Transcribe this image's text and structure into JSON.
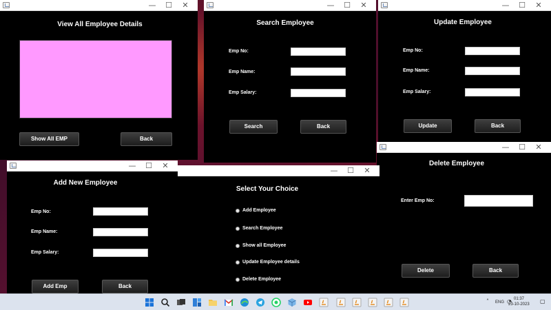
{
  "colors": {
    "window_bg": "#000000",
    "display_panel": "#ff99ff",
    "titlebar": "#ffffff",
    "taskbar": "#dce3ee"
  },
  "window_controls": {
    "minimize": "—",
    "maximize": "☐",
    "close": "✕"
  },
  "view_window": {
    "title": "View All Employee Details",
    "show_all_label": "Show All EMP",
    "back_label": "Back"
  },
  "search_window": {
    "title": "Search Employee",
    "emp_no_label": "Emp No:",
    "emp_name_label": "Emp Name:",
    "emp_salary_label": "Emp Salary:",
    "emp_no_value": "",
    "emp_name_value": "",
    "emp_salary_value": "",
    "search_label": "Search",
    "back_label": "Back"
  },
  "update_window": {
    "title": "Update Employee",
    "emp_no_label": "Emp No:",
    "emp_name_label": "Emp Name:",
    "emp_salary_label": "Emp Salary:",
    "emp_no_value": "",
    "emp_name_value": "",
    "emp_salary_value": "",
    "update_label": "Update",
    "back_label": "Back"
  },
  "delete_window": {
    "title": "Delete Employee",
    "emp_no_label": "Enter Emp No:",
    "emp_no_value": "",
    "delete_label": "Delete",
    "back_label": "Back"
  },
  "add_window": {
    "title": "Add New Employee",
    "emp_no_label": "Emp No:",
    "emp_name_label": "Emp Name:",
    "emp_salary_label": "Emp Salary:",
    "emp_no_value": "",
    "emp_name_value": "",
    "emp_salary_value": "",
    "add_label": "Add Emp",
    "back_label": "Back"
  },
  "choice_window": {
    "title": "Select Your Choice",
    "options": [
      "Add Employee",
      "Search Employee",
      "Show all Employee",
      "Update Employee details",
      "Delete Employee"
    ]
  },
  "taskbar": {
    "apps": [
      "windows-start-icon",
      "search-icon",
      "task-view-icon",
      "widgets-icon",
      "file-explorer-icon",
      "gmail-icon",
      "edge-icon",
      "telegram-icon",
      "whatsapp-icon",
      "box-icon",
      "youtube-icon",
      "java-app-icon",
      "java-app-icon",
      "java-app-icon",
      "java-app-icon",
      "java-app-icon",
      "java-app-icon"
    ],
    "language": "ENG",
    "time": "01:37",
    "date": "23-10-2023"
  }
}
